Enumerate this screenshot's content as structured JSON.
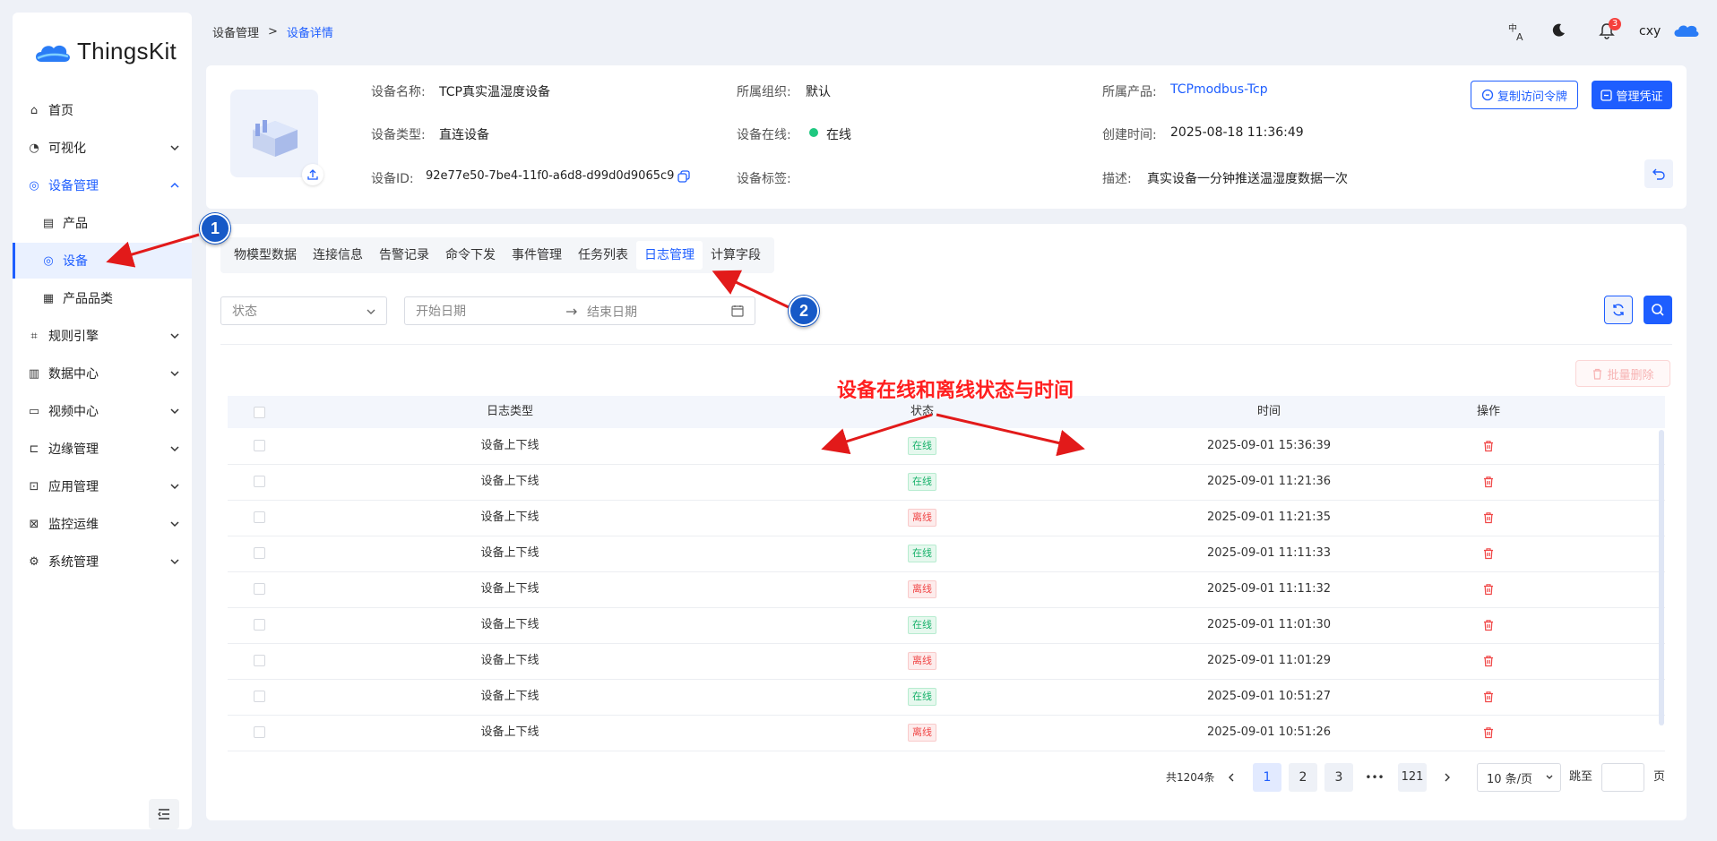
{
  "app": {
    "logo_text": "ThingsKit"
  },
  "sidebar": {
    "items": [
      {
        "label": "首页"
      },
      {
        "label": "可视化"
      },
      {
        "label": "设备管理"
      },
      {
        "label": "产品"
      },
      {
        "label": "设备"
      },
      {
        "label": "产品品类"
      },
      {
        "label": "规则引擎"
      },
      {
        "label": "数据中心"
      },
      {
        "label": "视频中心"
      },
      {
        "label": "边缘管理"
      },
      {
        "label": "应用管理"
      },
      {
        "label": "监控运维"
      },
      {
        "label": "系统管理"
      }
    ]
  },
  "breadcrumb": {
    "parent": "设备管理",
    "separator": ">",
    "current": "设备详情"
  },
  "header": {
    "notification_count": "3",
    "user": "cxy"
  },
  "device": {
    "name_label": "设备名称:",
    "name": "TCP真实温湿度设备",
    "type_label": "设备类型:",
    "type": "直连设备",
    "id_label": "设备ID:",
    "id": "92e77e50-7be4-11f0-a6d8-d99d0d9065c9",
    "org_label": "所属组织:",
    "org": "默认",
    "online_label": "设备在线:",
    "online": "在线",
    "tags_label": "设备标签:",
    "product_label": "所属产品:",
    "product": "TCPmodbus-Tcp",
    "created_label": "创建时间:",
    "created": "2025-08-18 11:36:49",
    "desc_label": "描述:",
    "desc": "真实设备一分钟推送温湿度数据一次"
  },
  "actions": {
    "copy_token": "复制访问令牌",
    "manage_cred": "管理凭证"
  },
  "tabs": [
    {
      "label": "物模型数据"
    },
    {
      "label": "连接信息"
    },
    {
      "label": "告警记录"
    },
    {
      "label": "命令下发"
    },
    {
      "label": "事件管理"
    },
    {
      "label": "任务列表"
    },
    {
      "label": "日志管理"
    },
    {
      "label": "计算字段"
    }
  ],
  "filters": {
    "status_placeholder": "状态",
    "start_placeholder": "开始日期",
    "end_placeholder": "结束日期",
    "batch_delete": "批量删除"
  },
  "table": {
    "headers": {
      "type": "日志类型",
      "status": "状态",
      "time": "时间",
      "action": "操作"
    },
    "rows": [
      {
        "type": "设备上下线",
        "status": "在线",
        "status_kind": "on",
        "time": "2025-09-01 15:36:39"
      },
      {
        "type": "设备上下线",
        "status": "在线",
        "status_kind": "on",
        "time": "2025-09-01 11:21:36"
      },
      {
        "type": "设备上下线",
        "status": "离线",
        "status_kind": "off",
        "time": "2025-09-01 11:21:35"
      },
      {
        "type": "设备上下线",
        "status": "在线",
        "status_kind": "on",
        "time": "2025-09-01 11:11:33"
      },
      {
        "type": "设备上下线",
        "status": "离线",
        "status_kind": "off",
        "time": "2025-09-01 11:11:32"
      },
      {
        "type": "设备上下线",
        "status": "在线",
        "status_kind": "on",
        "time": "2025-09-01 11:01:30"
      },
      {
        "type": "设备上下线",
        "status": "离线",
        "status_kind": "off",
        "time": "2025-09-01 11:01:29"
      },
      {
        "type": "设备上下线",
        "status": "在线",
        "status_kind": "on",
        "time": "2025-09-01 10:51:27"
      },
      {
        "type": "设备上下线",
        "status": "离线",
        "status_kind": "off",
        "time": "2025-09-01 10:51:26"
      }
    ]
  },
  "pagination": {
    "total": "共1204条",
    "pages": [
      "1",
      "2",
      "3"
    ],
    "ellipsis": "•••",
    "last": "121",
    "page_size": "10 条/页",
    "jump_label": "跳至",
    "page_suffix": "页"
  },
  "annotations": {
    "marker1": "1",
    "marker2": "2",
    "note": "设备在线和离线状态与时间"
  },
  "colors": {
    "accent": "#1e5eff",
    "online": "#19b26b",
    "offline": "#f04747",
    "annotation": "#ff1f1f"
  }
}
